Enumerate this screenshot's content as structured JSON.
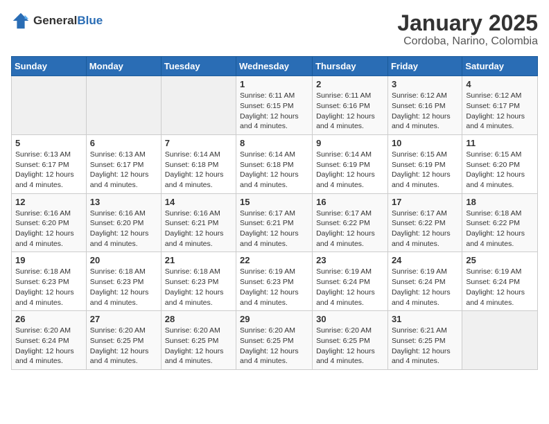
{
  "header": {
    "logo": {
      "general": "General",
      "blue": "Blue"
    },
    "month": "January 2025",
    "location": "Cordoba, Narino, Colombia"
  },
  "weekdays": [
    "Sunday",
    "Monday",
    "Tuesday",
    "Wednesday",
    "Thursday",
    "Friday",
    "Saturday"
  ],
  "weeks": [
    [
      {
        "day": "",
        "info": ""
      },
      {
        "day": "",
        "info": ""
      },
      {
        "day": "",
        "info": ""
      },
      {
        "day": "1",
        "info": "Sunrise: 6:11 AM\nSunset: 6:15 PM\nDaylight: 12 hours and 4 minutes."
      },
      {
        "day": "2",
        "info": "Sunrise: 6:11 AM\nSunset: 6:16 PM\nDaylight: 12 hours and 4 minutes."
      },
      {
        "day": "3",
        "info": "Sunrise: 6:12 AM\nSunset: 6:16 PM\nDaylight: 12 hours and 4 minutes."
      },
      {
        "day": "4",
        "info": "Sunrise: 6:12 AM\nSunset: 6:17 PM\nDaylight: 12 hours and 4 minutes."
      }
    ],
    [
      {
        "day": "5",
        "info": "Sunrise: 6:13 AM\nSunset: 6:17 PM\nDaylight: 12 hours and 4 minutes."
      },
      {
        "day": "6",
        "info": "Sunrise: 6:13 AM\nSunset: 6:17 PM\nDaylight: 12 hours and 4 minutes."
      },
      {
        "day": "7",
        "info": "Sunrise: 6:14 AM\nSunset: 6:18 PM\nDaylight: 12 hours and 4 minutes."
      },
      {
        "day": "8",
        "info": "Sunrise: 6:14 AM\nSunset: 6:18 PM\nDaylight: 12 hours and 4 minutes."
      },
      {
        "day": "9",
        "info": "Sunrise: 6:14 AM\nSunset: 6:19 PM\nDaylight: 12 hours and 4 minutes."
      },
      {
        "day": "10",
        "info": "Sunrise: 6:15 AM\nSunset: 6:19 PM\nDaylight: 12 hours and 4 minutes."
      },
      {
        "day": "11",
        "info": "Sunrise: 6:15 AM\nSunset: 6:20 PM\nDaylight: 12 hours and 4 minutes."
      }
    ],
    [
      {
        "day": "12",
        "info": "Sunrise: 6:16 AM\nSunset: 6:20 PM\nDaylight: 12 hours and 4 minutes."
      },
      {
        "day": "13",
        "info": "Sunrise: 6:16 AM\nSunset: 6:20 PM\nDaylight: 12 hours and 4 minutes."
      },
      {
        "day": "14",
        "info": "Sunrise: 6:16 AM\nSunset: 6:21 PM\nDaylight: 12 hours and 4 minutes."
      },
      {
        "day": "15",
        "info": "Sunrise: 6:17 AM\nSunset: 6:21 PM\nDaylight: 12 hours and 4 minutes."
      },
      {
        "day": "16",
        "info": "Sunrise: 6:17 AM\nSunset: 6:22 PM\nDaylight: 12 hours and 4 minutes."
      },
      {
        "day": "17",
        "info": "Sunrise: 6:17 AM\nSunset: 6:22 PM\nDaylight: 12 hours and 4 minutes."
      },
      {
        "day": "18",
        "info": "Sunrise: 6:18 AM\nSunset: 6:22 PM\nDaylight: 12 hours and 4 minutes."
      }
    ],
    [
      {
        "day": "19",
        "info": "Sunrise: 6:18 AM\nSunset: 6:23 PM\nDaylight: 12 hours and 4 minutes."
      },
      {
        "day": "20",
        "info": "Sunrise: 6:18 AM\nSunset: 6:23 PM\nDaylight: 12 hours and 4 minutes."
      },
      {
        "day": "21",
        "info": "Sunrise: 6:18 AM\nSunset: 6:23 PM\nDaylight: 12 hours and 4 minutes."
      },
      {
        "day": "22",
        "info": "Sunrise: 6:19 AM\nSunset: 6:23 PM\nDaylight: 12 hours and 4 minutes."
      },
      {
        "day": "23",
        "info": "Sunrise: 6:19 AM\nSunset: 6:24 PM\nDaylight: 12 hours and 4 minutes."
      },
      {
        "day": "24",
        "info": "Sunrise: 6:19 AM\nSunset: 6:24 PM\nDaylight: 12 hours and 4 minutes."
      },
      {
        "day": "25",
        "info": "Sunrise: 6:19 AM\nSunset: 6:24 PM\nDaylight: 12 hours and 4 minutes."
      }
    ],
    [
      {
        "day": "26",
        "info": "Sunrise: 6:20 AM\nSunset: 6:24 PM\nDaylight: 12 hours and 4 minutes."
      },
      {
        "day": "27",
        "info": "Sunrise: 6:20 AM\nSunset: 6:25 PM\nDaylight: 12 hours and 4 minutes."
      },
      {
        "day": "28",
        "info": "Sunrise: 6:20 AM\nSunset: 6:25 PM\nDaylight: 12 hours and 4 minutes."
      },
      {
        "day": "29",
        "info": "Sunrise: 6:20 AM\nSunset: 6:25 PM\nDaylight: 12 hours and 4 minutes."
      },
      {
        "day": "30",
        "info": "Sunrise: 6:20 AM\nSunset: 6:25 PM\nDaylight: 12 hours and 4 minutes."
      },
      {
        "day": "31",
        "info": "Sunrise: 6:21 AM\nSunset: 6:25 PM\nDaylight: 12 hours and 4 minutes."
      },
      {
        "day": "",
        "info": ""
      }
    ]
  ]
}
